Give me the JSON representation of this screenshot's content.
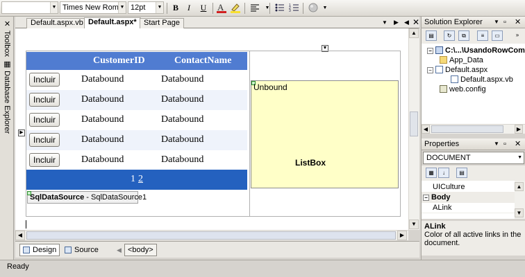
{
  "toolbar": {
    "block_format": "",
    "font_name": "Times New Roman",
    "font_size": "12pt",
    "bold_label": "B",
    "italic_label": "I",
    "underline_label": "U"
  },
  "left_strip": {
    "toolbox_label": "Toolbox",
    "database_explorer_label": "Database Explorer"
  },
  "doc_tabs": [
    {
      "label": "Default.aspx.vb"
    },
    {
      "label": "Default.aspx*"
    },
    {
      "label": "Start Page"
    }
  ],
  "gridview": {
    "headers": [
      "CustomerID",
      "ContactName"
    ],
    "rows": [
      {
        "button": "Incluir",
        "col1": "Databound",
        "col2": "Databound"
      },
      {
        "button": "Incluir",
        "col1": "Databound",
        "col2": "Databound"
      },
      {
        "button": "Incluir",
        "col1": "Databound",
        "col2": "Databound"
      },
      {
        "button": "Incluir",
        "col1": "Databound",
        "col2": "Databound"
      },
      {
        "button": "Incluir",
        "col1": "Databound",
        "col2": "Databound"
      }
    ],
    "pager": [
      "1",
      "2"
    ]
  },
  "sqldatasource": {
    "type": "SqlDataSource",
    "name": " - SqlDataSource1"
  },
  "listbox": {
    "unbound_label": "Unbound",
    "name": "ListBox"
  },
  "bottom_bar": {
    "design_label": "Design",
    "source_label": "Source",
    "body_tag": "<body>"
  },
  "solution_explorer": {
    "title": "Solution Explorer",
    "items": [
      {
        "label": "C:\\...\\UsandoRowComm"
      },
      {
        "label": "App_Data"
      },
      {
        "label": "Default.aspx"
      },
      {
        "label": "Default.aspx.vb"
      },
      {
        "label": "web.config"
      }
    ]
  },
  "properties": {
    "title": "Properties",
    "object": "DOCUMENT",
    "rows": [
      {
        "name": "UICulture",
        "value": ""
      },
      {
        "name": "Body",
        "value": ""
      },
      {
        "name": "ALink",
        "value": ""
      }
    ],
    "desc_title": "ALink",
    "desc_text": "Color of all active links in the document."
  },
  "status": {
    "text": "Ready"
  }
}
